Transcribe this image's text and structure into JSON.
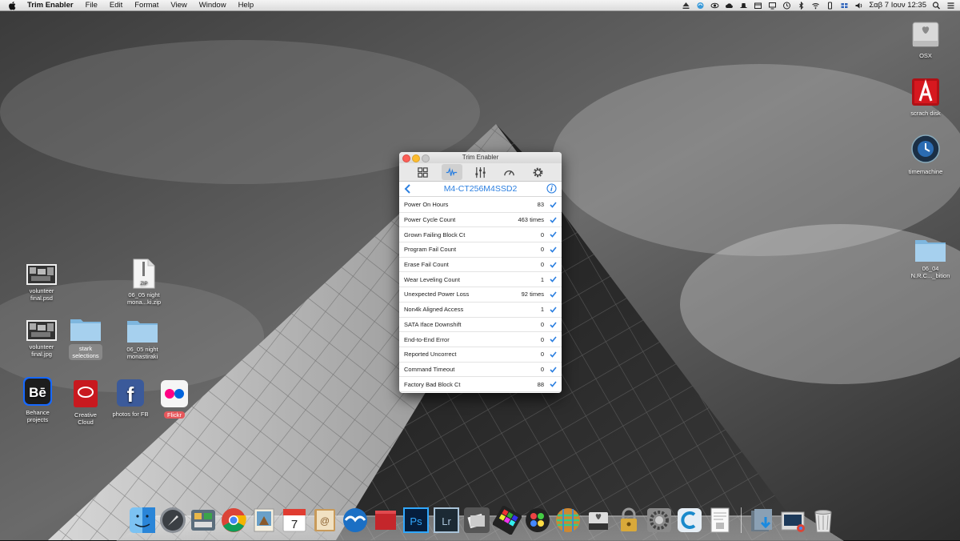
{
  "menubar": {
    "app_name": "Trim Enabler",
    "items": [
      "File",
      "Edit",
      "Format",
      "View",
      "Window",
      "Help"
    ],
    "clock": "Σαβ 7 Ιουν  12:35"
  },
  "desktop_left": [
    {
      "label1": "volunteer",
      "label2": "final.psd"
    },
    {
      "label1": "06_05 night",
      "label2": "mona...ki.zip",
      "badge": "ZIP"
    },
    {
      "label1": "volunteer",
      "label2": "final.jpg"
    },
    {
      "label1": "stark",
      "label2": "selections"
    },
    {
      "label1": "06_05 night",
      "label2": "monastiraki"
    },
    {
      "label1": "Behance",
      "label2": "projects"
    },
    {
      "label1": "Creative",
      "label2": "Cloud"
    },
    {
      "label1": "photos for FB"
    },
    {
      "label1": "Flickr"
    }
  ],
  "desktop_right": [
    {
      "label1": "OSX"
    },
    {
      "label1": "scrach disk"
    },
    {
      "label1": "timemachine"
    },
    {
      "label1": "06_04",
      "label2": "N.R.C..._bition"
    }
  ],
  "window": {
    "title": "Trim Enabler",
    "drive": "M4-CT256M4SSD2",
    "rows": [
      {
        "name": "Power On Hours",
        "value": "83"
      },
      {
        "name": "Power Cycle Count",
        "value": "463 times"
      },
      {
        "name": "Grown Failing Block Ct",
        "value": "0"
      },
      {
        "name": "Program Fail Count",
        "value": "0"
      },
      {
        "name": "Erase Fail Count",
        "value": "0"
      },
      {
        "name": "Wear Leveling Count",
        "value": "1"
      },
      {
        "name": "Unexpected Power Loss",
        "value": "92 times"
      },
      {
        "name": "Non4k Aligned Access",
        "value": "1"
      },
      {
        "name": "SATA Iface Downshift",
        "value": "0"
      },
      {
        "name": "End-to-End Error",
        "value": "0"
      },
      {
        "name": "Reported Uncorrect",
        "value": "0"
      },
      {
        "name": "Command Timeout",
        "value": "0"
      },
      {
        "name": "Factory Bad Block Ct",
        "value": "88"
      }
    ]
  },
  "colors": {
    "accent": "#2b7fe0",
    "close": "#fc5f57",
    "minimize": "#fdbc2e",
    "zoom": "#c8c8c8"
  }
}
